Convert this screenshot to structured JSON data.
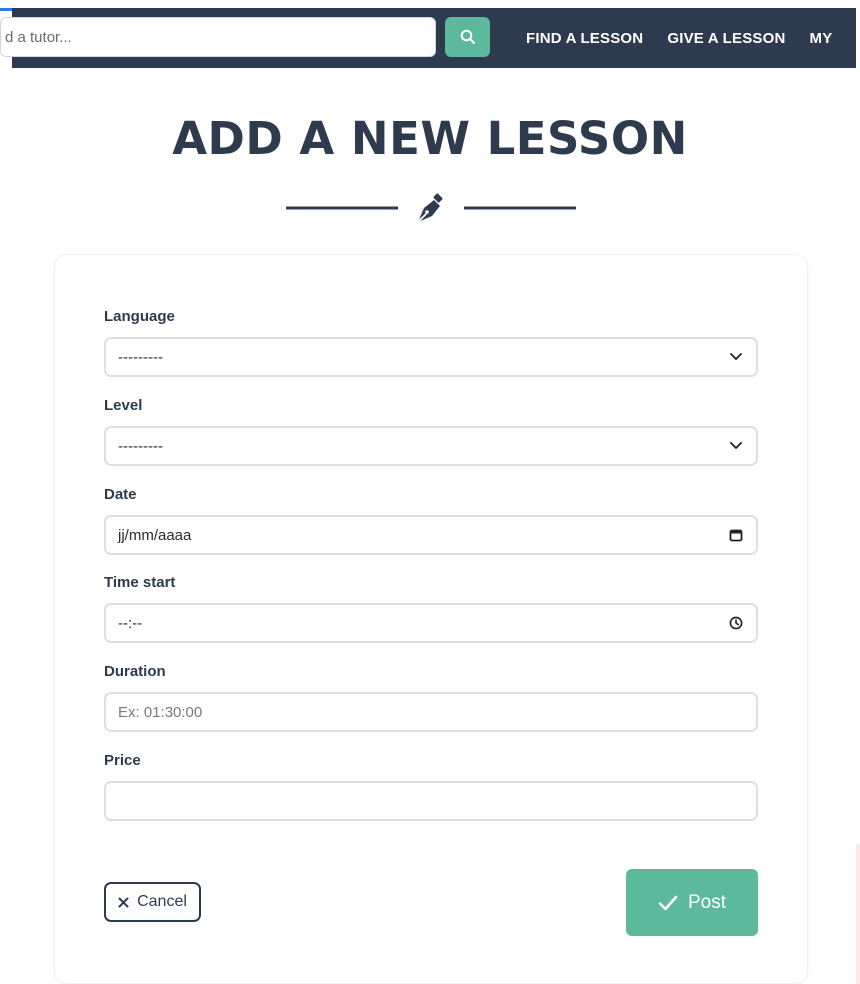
{
  "search": {
    "placeholder": "d a tutor...",
    "button_icon": "search-icon"
  },
  "nav": {
    "links": [
      {
        "label": "FIND A LESSON"
      },
      {
        "label": "GIVE A LESSON"
      },
      {
        "label": "MY"
      }
    ]
  },
  "page": {
    "title": "ADD A NEW LESSON",
    "divider_icon": "fountain-pen-icon"
  },
  "form": {
    "language": {
      "label": "Language",
      "value": "---------",
      "icon": "chevron-down-icon"
    },
    "level": {
      "label": "Level",
      "value": "---------",
      "icon": "chevron-down-icon"
    },
    "date": {
      "label": "Date",
      "value": "jj/mm/aaaa",
      "icon": "calendar-icon"
    },
    "time_start": {
      "label": "Time start",
      "value": "--:--",
      "icon": "clock-icon"
    },
    "duration": {
      "label": "Duration",
      "placeholder": "Ex: 01:30:00"
    },
    "price": {
      "label": "Price",
      "placeholder": ""
    }
  },
  "actions": {
    "cancel_label": "Cancel",
    "cancel_icon": "close-icon",
    "post_label": "Post",
    "post_icon": "check-icon"
  },
  "colors": {
    "navbar": "#2e3b4e",
    "accent": "#5cb99b",
    "text_dark": "#2e3b4e"
  }
}
